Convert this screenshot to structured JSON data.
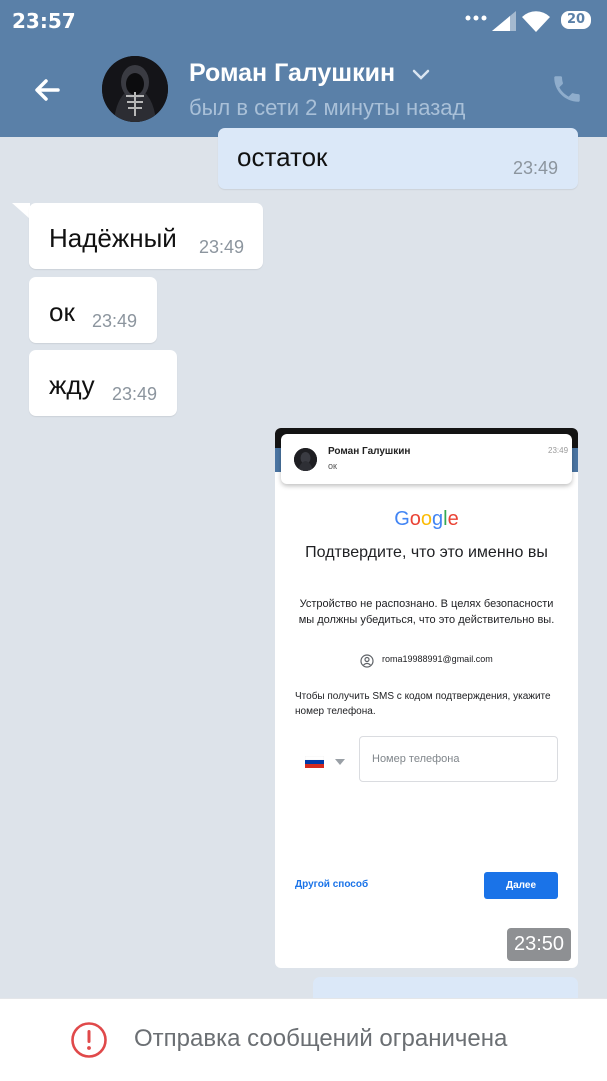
{
  "status_bar": {
    "time": "23:57",
    "battery": "20"
  },
  "header": {
    "contact_name": "Роман Галушкин",
    "last_seen": "был в сети 2 минуты назад"
  },
  "messages": [
    {
      "direction": "out",
      "text": "остаток",
      "time": "23:49"
    },
    {
      "direction": "in",
      "text": "Надёжный",
      "time": "23:49"
    },
    {
      "direction": "in",
      "text": "ок",
      "time": "23:49"
    },
    {
      "direction": "in",
      "text": "жду",
      "time": "23:49"
    }
  ],
  "attachment": {
    "time": "23:50",
    "notification": {
      "name": "Роман Галушкин",
      "message": "ок",
      "time": "23:49"
    },
    "google": {
      "logo": "Google",
      "title": "Подтвердите, что это именно вы",
      "description": "Устройство не распознано. В целях безопасности мы должны убедиться, что это действительно вы.",
      "email": "roma19988991@gmail.com",
      "prompt": "Чтобы получить SMS с кодом подтверждения, укажите номер телефона.",
      "phone_placeholder": "Номер телефона",
      "other_way": "Другой способ",
      "next": "Далее"
    }
  },
  "footer": {
    "restricted": "Отправка сообщений ограничена"
  },
  "colors": {
    "header": "#5a80a8",
    "chat_bg": "#dde3ea",
    "outgoing": "#dbe8f8",
    "incoming": "#ffffff",
    "google_blue": "#1a73e8",
    "warning": "#e0494a"
  }
}
